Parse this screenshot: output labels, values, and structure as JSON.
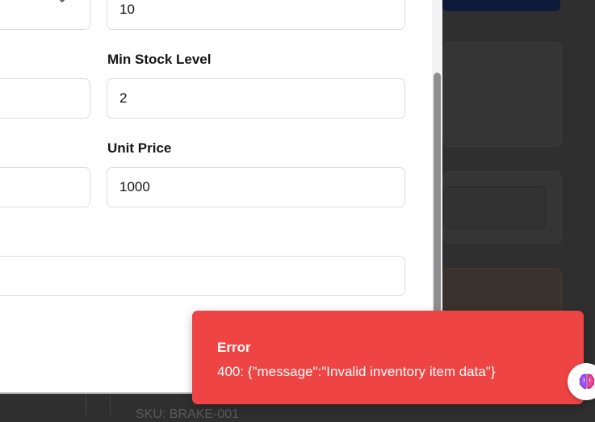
{
  "form": {
    "quantity_value": "10",
    "min_stock_label": "Min Stock Level",
    "min_stock_value": "2",
    "unit_price_label": "Unit Price",
    "unit_price_value": "1000"
  },
  "toast": {
    "title": "Error",
    "message": "400: {\"message\":\"Invalid inventory item data\"}",
    "color": "#ef4444"
  },
  "background": {
    "sku_text": "SKU: BRAKE-001"
  },
  "icons": {
    "select_chevron": "chevron-down-icon",
    "assistant": "brain-icon"
  }
}
